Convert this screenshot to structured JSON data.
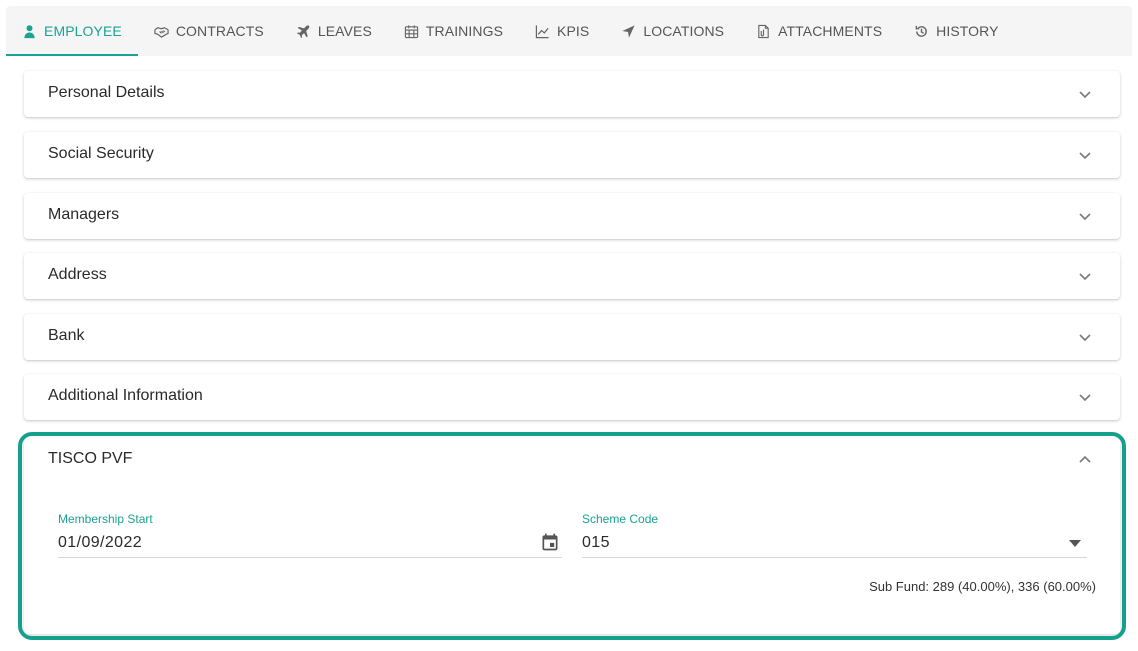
{
  "tabs": [
    {
      "label": "Employee",
      "icon": "user-icon",
      "active": true
    },
    {
      "label": "Contracts",
      "icon": "handshake-icon"
    },
    {
      "label": "Leaves",
      "icon": "plane-icon"
    },
    {
      "label": "Trainings",
      "icon": "calendar-grid-icon"
    },
    {
      "label": "KPIs",
      "icon": "line-chart-icon"
    },
    {
      "label": "Locations",
      "icon": "location-arrow-icon"
    },
    {
      "label": "Attachments",
      "icon": "file-attachment-icon"
    },
    {
      "label": "History",
      "icon": "history-icon"
    }
  ],
  "panels": [
    {
      "title": "Personal Details"
    },
    {
      "title": "Social Security"
    },
    {
      "title": "Managers"
    },
    {
      "title": "Address"
    },
    {
      "title": "Bank"
    },
    {
      "title": "Additional Information"
    }
  ],
  "pvf": {
    "title": "TISCO PVF",
    "membership_start": {
      "label": "Membership Start",
      "value": "01/09/2022"
    },
    "scheme_code": {
      "label": "Scheme Code",
      "value": "015"
    },
    "sub_fund": "Sub Fund: 289 (40.00%), 336 (60.00%)"
  },
  "colors": {
    "accent": "#1aa392",
    "highlight": "#15a08d"
  }
}
